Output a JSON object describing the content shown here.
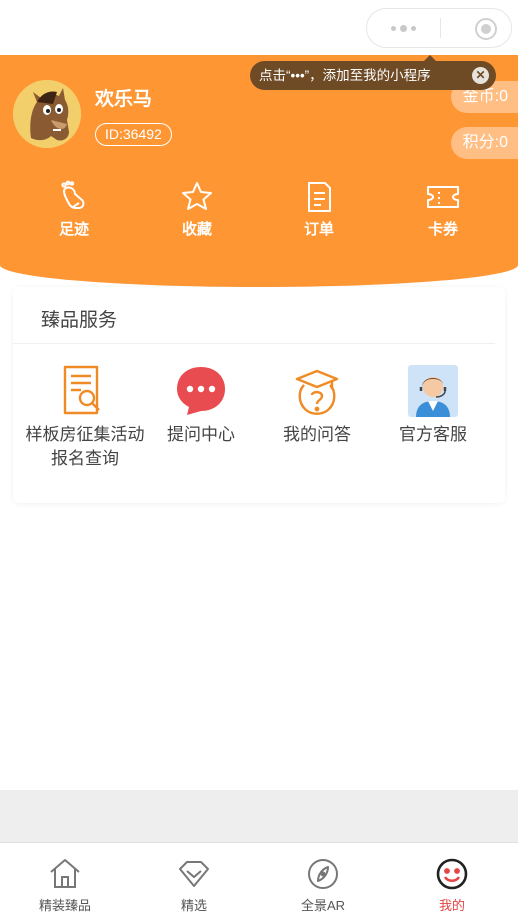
{
  "navbar": {
    "capsule": {
      "more_icon": "more-dots-icon",
      "minimize_icon": "minimize-icon",
      "close_icon": "target-close-icon"
    }
  },
  "tooltip": {
    "text": "点击“•••”，添加至我的小程序",
    "close_label": "✕"
  },
  "profile": {
    "name": "欢乐马",
    "id_label": "ID:36492",
    "avatar_icon": "horse-avatar",
    "coins_label": "金币:0",
    "points_label": "积分:0"
  },
  "quick_actions": [
    {
      "label": "足迹",
      "icon": "footprint-icon"
    },
    {
      "label": "收藏",
      "icon": "star-icon"
    },
    {
      "label": "订单",
      "icon": "order-icon"
    },
    {
      "label": "卡券",
      "icon": "coupon-icon"
    }
  ],
  "services": {
    "title": "臻品服务",
    "items": [
      {
        "label": "样板房征集活动报名查询",
        "icon": "document-search-icon"
      },
      {
        "label": "提问中心",
        "icon": "chat-bubble-icon"
      },
      {
        "label": "我的问答",
        "icon": "graduation-question-icon"
      },
      {
        "label": "官方客服",
        "icon": "customer-service-icon"
      }
    ]
  },
  "tabbar": {
    "items": [
      {
        "label": "精装臻品",
        "icon": "home-icon",
        "active": false
      },
      {
        "label": "精选",
        "icon": "diamond-icon",
        "active": false
      },
      {
        "label": "全景AR",
        "icon": "compass-icon",
        "active": false
      },
      {
        "label": "我的",
        "icon": "smile-face-icon",
        "active": true
      }
    ]
  },
  "colors": {
    "header_orange": "#ff9634",
    "tooltip_brown": "#6e4a25",
    "service_orange": "#f08a24",
    "chat_red": "#e84c50",
    "active_red": "#e64545"
  }
}
